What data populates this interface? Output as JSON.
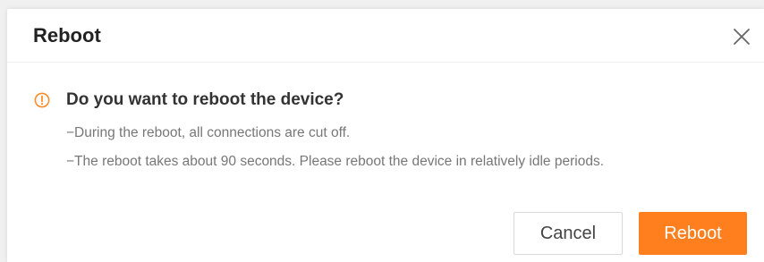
{
  "dialog": {
    "title": "Reboot",
    "close_icon": "close-icon",
    "question": "Do you want to reboot the device?",
    "notes": [
      "−During the reboot, all connections are cut off.",
      "−The reboot takes about 90 seconds. Please reboot the device in relatively idle periods."
    ],
    "warning_icon": "warning-circle-icon",
    "buttons": {
      "cancel_label": "Cancel",
      "confirm_label": "Reboot"
    }
  },
  "colors": {
    "accent": "#ff7f1e",
    "warning": "#ff8c2a",
    "title_text": "#222222",
    "body_text": "#777777"
  }
}
